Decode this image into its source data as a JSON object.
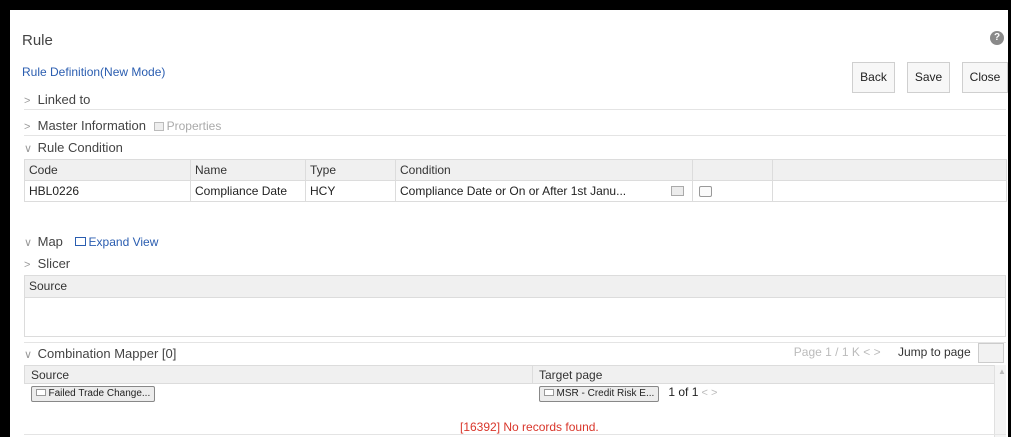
{
  "page": {
    "title": "Rule",
    "subtitle": "Rule Definition(New Mode)",
    "help_icon_glyph": "?"
  },
  "toolbar": {
    "back_label": "Back",
    "save_label": "Save",
    "close_label": "Close"
  },
  "sections": {
    "linked_to": "Linked to",
    "master_information": "Master Information",
    "properties": "Properties",
    "rule_condition": "Rule Condition",
    "map": "Map",
    "expand_view": "Expand View",
    "slicer": "Slicer",
    "combination_mapper": "Combination Mapper [0]"
  },
  "chevrons": {
    "collapsed": ">",
    "expanded": "∨"
  },
  "rule_condition": {
    "columns": [
      "Code",
      "Name",
      "Type",
      "Condition",
      "",
      ""
    ],
    "rows": [
      {
        "code": "HBL0226",
        "name": "Compliance Date",
        "type": "HCY",
        "condition": "Compliance Date or On or After 1st Janu..."
      }
    ]
  },
  "source_box": {
    "header": "Source"
  },
  "pager": {
    "page_info": "Page 1 / 1",
    "first": "K",
    "prev": "<",
    "next": ">",
    "jump_label": "Jump to page"
  },
  "combination_mapper": {
    "columns": [
      "Source",
      "Target page"
    ],
    "source_chip": "Failed Trade Change...",
    "target_chip": "MSR - Credit Risk E...",
    "target_page_info": "1 of 1",
    "target_prev": "<",
    "target_next": ">",
    "message": "[16392] No records found."
  },
  "icons": {
    "help": "question-circle-icon",
    "properties": "properties-icon",
    "condition_edit": "edit-condition-icon",
    "action": "pin-icon",
    "expand_view": "expand-view-icon",
    "chip": "hierarchy-icon"
  },
  "colors": {
    "link": "#2a5db0",
    "error": "#d9362b",
    "header_bg": "#f0f0f0",
    "border": "#dcdcdc"
  }
}
